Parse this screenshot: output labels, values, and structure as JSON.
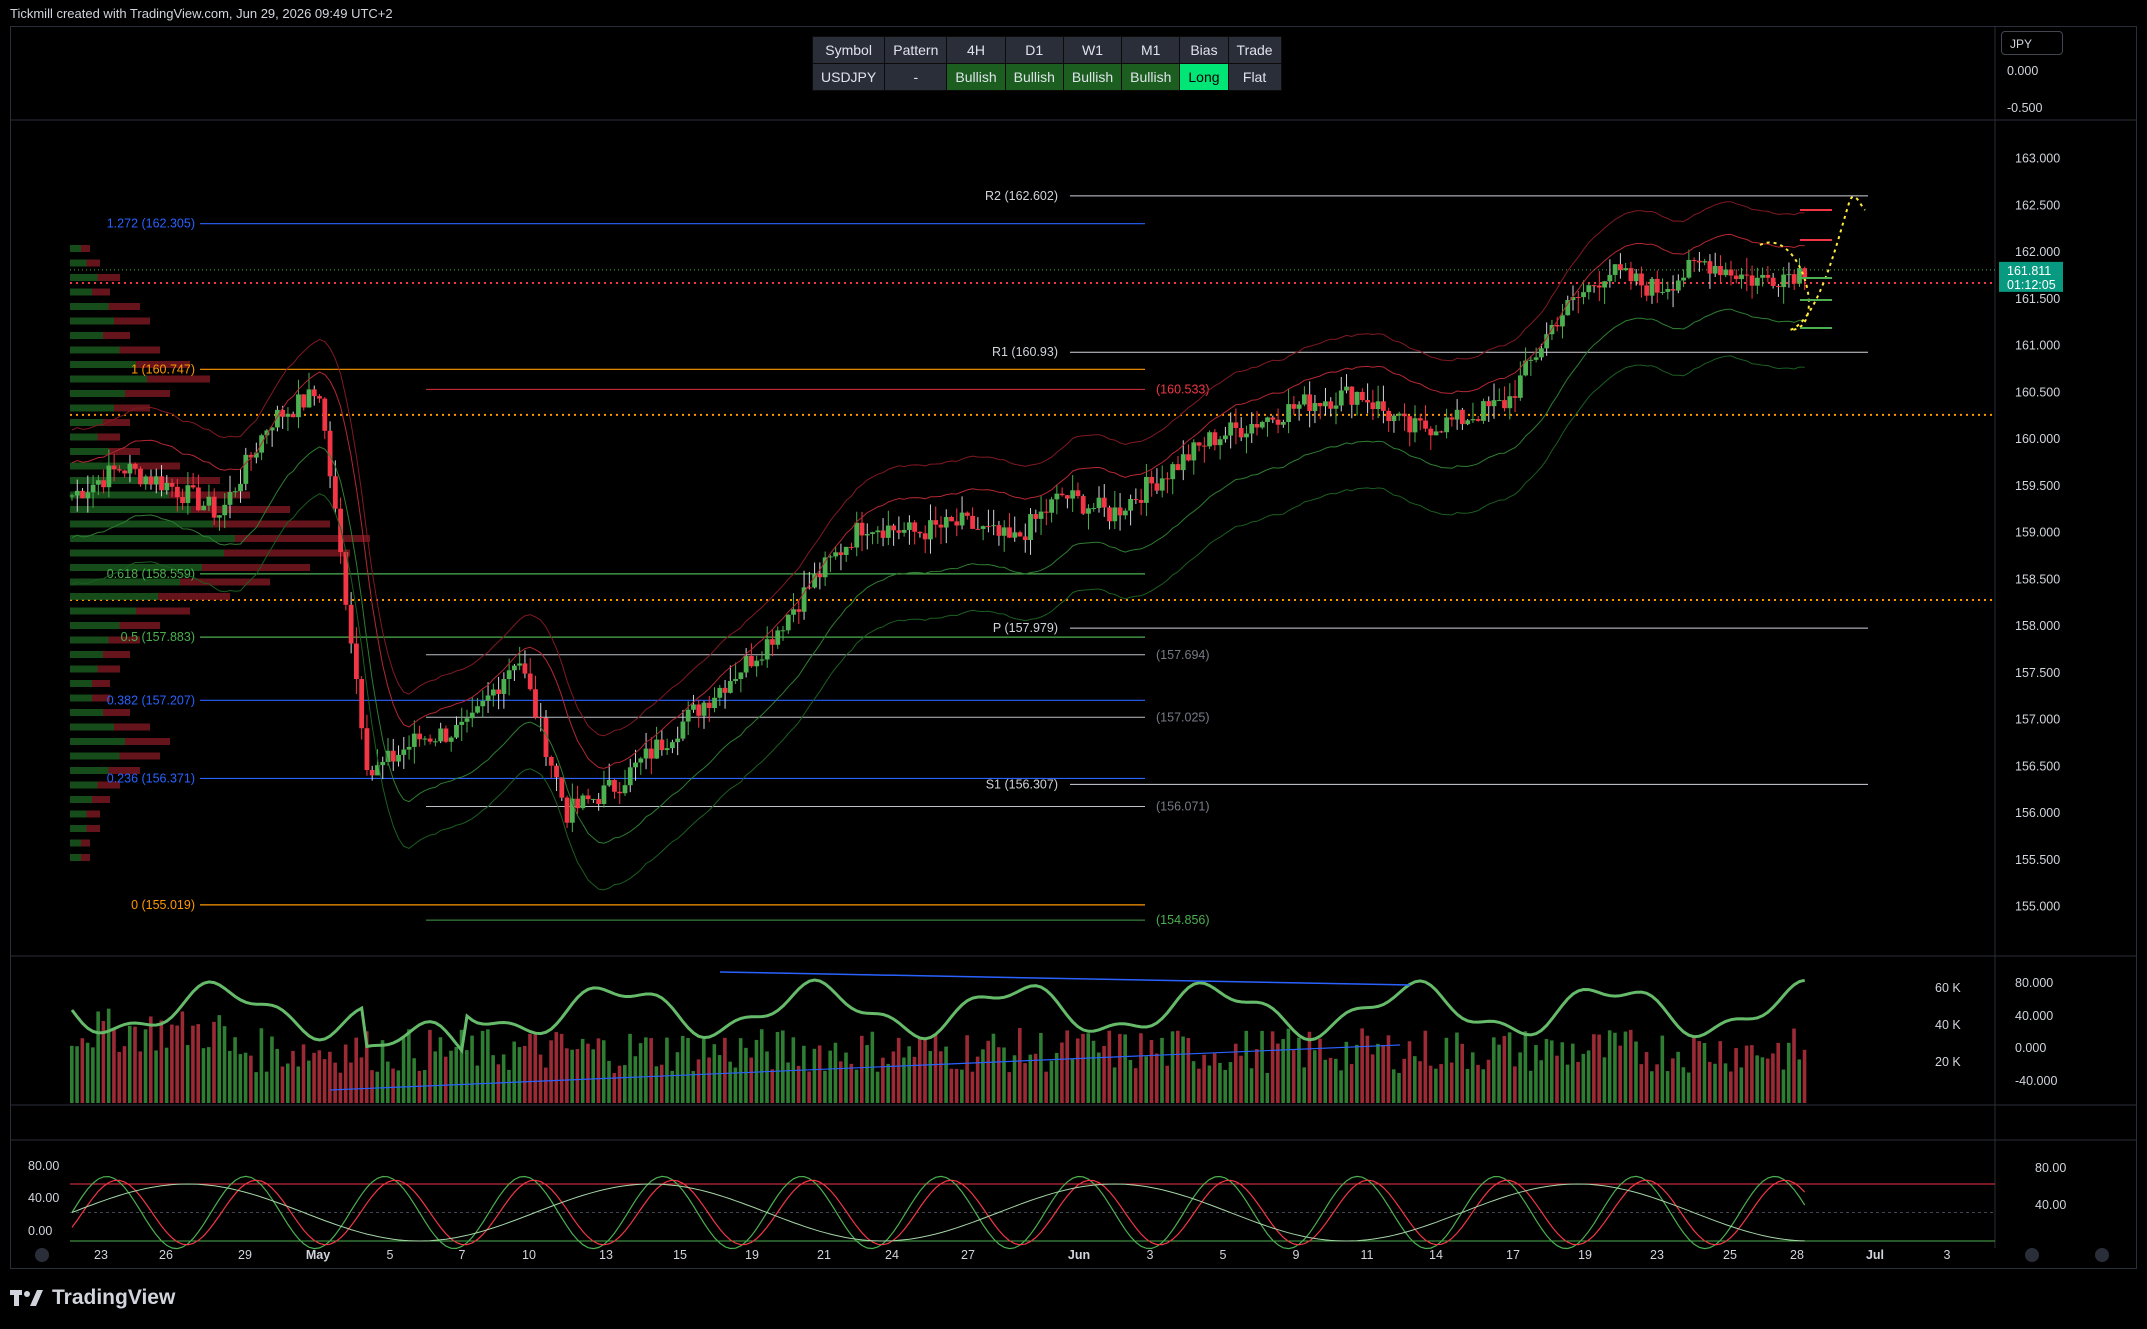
{
  "header": {
    "attribution": "Tickmill created with TradingView.com, Jun 29, 2026 09:49 UTC+2"
  },
  "brand": {
    "name": "TradingView"
  },
  "currency_badge": "JPY",
  "signal_table": {
    "headers": [
      "Symbol",
      "Pattern",
      "4H",
      "D1",
      "W1",
      "M1",
      "Bias",
      "Trade"
    ],
    "row": [
      "USDJPY",
      "-",
      "Bullish",
      "Bullish",
      "Bullish",
      "Bullish",
      "Long",
      "Flat"
    ]
  },
  "colors": {
    "bull": "#4caf50",
    "bear": "#f23645",
    "pivot_line": "#d1d4dc",
    "fib_blue": "#2962ff",
    "fib_orange": "#ff9800",
    "long_cell": "#00e676",
    "bullish_cell": "#1b5e20",
    "price_tag": "#089981"
  },
  "chart_data": [
    {
      "type": "candlestick",
      "symbol": "USDJPY",
      "y_axis_ticks": [
        "163.000",
        "162.500",
        "162.000",
        "161.500",
        "161.000",
        "160.500",
        "160.000",
        "159.500",
        "159.000",
        "158.500",
        "158.000",
        "157.500",
        "157.000",
        "156.500",
        "156.000",
        "155.500",
        "155.000"
      ],
      "ylim": [
        154.75,
        163.2
      ],
      "x_axis_ticks": [
        "23",
        "26",
        "29",
        "May",
        "5",
        "7",
        "10",
        "13",
        "15",
        "19",
        "21",
        "24",
        "27",
        "Jun",
        "3",
        "5",
        "9",
        "11",
        "14",
        "17",
        "19",
        "23",
        "25",
        "28",
        "Jul",
        "3"
      ],
      "last_price": "161.811",
      "countdown": "01:12:05",
      "close_path": [
        {
          "date": "Apr 22",
          "close": 159.4
        },
        {
          "date": "Apr 24",
          "close": 159.7
        },
        {
          "date": "Apr 26",
          "close": 159.5
        },
        {
          "date": "Apr 28",
          "close": 159.2
        },
        {
          "date": "Apr 30",
          "close": 160.2
        },
        {
          "date": "May 1",
          "close": 160.5
        },
        {
          "date": "May 2",
          "close": 156.4
        },
        {
          "date": "May 3",
          "close": 156.8
        },
        {
          "date": "May 4",
          "close": 156.9
        },
        {
          "date": "May 5",
          "close": 157.7
        },
        {
          "date": "May 6",
          "close": 156.0
        },
        {
          "date": "May 7",
          "close": 156.3
        },
        {
          "date": "May 9",
          "close": 156.8
        },
        {
          "date": "May 11",
          "close": 157.3
        },
        {
          "date": "May 13",
          "close": 157.8
        },
        {
          "date": "May 15",
          "close": 158.5
        },
        {
          "date": "May 17",
          "close": 159.1
        },
        {
          "date": "May 20",
          "close": 159.0
        },
        {
          "date": "May 22",
          "close": 159.1
        },
        {
          "date": "May 24",
          "close": 158.9
        },
        {
          "date": "May 27",
          "close": 159.4
        },
        {
          "date": "May 29",
          "close": 159.2
        },
        {
          "date": "Jun 1",
          "close": 159.6
        },
        {
          "date": "Jun 3",
          "close": 160.0
        },
        {
          "date": "Jun 6",
          "close": 160.2
        },
        {
          "date": "Jun 9",
          "close": 160.4
        },
        {
          "date": "Jun 11",
          "close": 160.5
        },
        {
          "date": "Jun 12",
          "close": 160.1
        },
        {
          "date": "Jun 15",
          "close": 160.2
        },
        {
          "date": "Jun 17",
          "close": 160.4
        },
        {
          "date": "Jun 19",
          "close": 161.3
        },
        {
          "date": "Jun 21",
          "close": 161.8
        },
        {
          "date": "Jun 23",
          "close": 161.6
        },
        {
          "date": "Jun 25",
          "close": 161.9
        },
        {
          "date": "Jun 26",
          "close": 161.7
        },
        {
          "date": "Jun 28",
          "close": 161.811
        }
      ],
      "pivot_levels": [
        {
          "label": "R2 (162.602)",
          "value": 162.602
        },
        {
          "label": "R1 (160.93)",
          "value": 160.93
        },
        {
          "label": "P (157.979)",
          "value": 157.979
        },
        {
          "label": "S1 (156.307)",
          "value": 156.307
        }
      ],
      "fib_levels": [
        {
          "label": "1.272 (162.305)",
          "value": 162.305
        },
        {
          "label": "1 (160.747)",
          "value": 160.747
        },
        {
          "label": "0.618 (158.559)",
          "value": 158.559
        },
        {
          "label": "0.5 (157.883)",
          "value": 157.883
        },
        {
          "label": "0.382 (157.207)",
          "value": 157.207
        },
        {
          "label": "0.236 (156.371)",
          "value": 156.371
        },
        {
          "label": "0 (155.019)",
          "value": 155.019
        }
      ],
      "extra_levels": [
        {
          "label": "(160.533)",
          "value": 160.533
        },
        {
          "label": "(157.694)",
          "value": 157.694
        },
        {
          "label": "(157.025)",
          "value": 157.025
        },
        {
          "label": "(156.071)",
          "value": 156.071
        },
        {
          "label": "(154.856)",
          "value": 154.856
        }
      ],
      "dotted_levels": [
        161.67,
        160.26,
        158.28
      ]
    },
    {
      "type": "bar",
      "name": "volume_oscillator",
      "y_axis_ticks_left": [
        "60 K",
        "40 K",
        "20 K"
      ],
      "y_axis_ticks_right": [
        "80.000",
        "40.000",
        "0.000",
        "-40.000"
      ]
    },
    {
      "type": "line",
      "name": "stochastic",
      "y_axis_ticks_left": [
        "80.00",
        "40.00",
        "0.00"
      ],
      "y_axis_ticks_right": [
        "80.00",
        "40.00"
      ]
    },
    {
      "type": "line",
      "name": "top_oscillator",
      "y_axis_ticks": [
        "0.000",
        "-0.500"
      ]
    }
  ]
}
